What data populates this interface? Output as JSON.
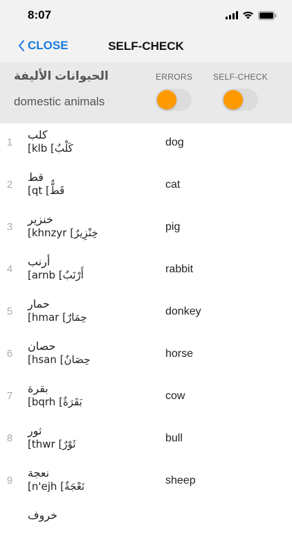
{
  "status": {
    "time": "8:07"
  },
  "nav": {
    "back_label": "CLOSE",
    "title": "SELF-CHECK"
  },
  "header": {
    "arabic_title": "الحيوانات الأليفة",
    "english_title": "domestic animals",
    "errors_label": "ERRORS",
    "selfcheck_label": "SELF-CHECK",
    "accent_color": "#ff9900"
  },
  "words": [
    {
      "num": "1",
      "ar": "كلب",
      "translit": "[klb [كَلْبٌ",
      "en": "dog"
    },
    {
      "num": "2",
      "ar": "قط",
      "translit": "[qt [قَطٌّ",
      "en": "cat"
    },
    {
      "num": "3",
      "ar": "خنزير",
      "translit": "[khnzyr [خِنْزِيرٌ",
      "en": "pig"
    },
    {
      "num": "4",
      "ar": "أرنب",
      "translit": "[arnb [أَرْنَبٌ",
      "en": "rabbit"
    },
    {
      "num": "5",
      "ar": "حمار",
      "translit": "[hmar [حِمَارٌ",
      "en": "donkey"
    },
    {
      "num": "6",
      "ar": "حصان",
      "translit": "[hsan [حِصَانٌ",
      "en": "horse"
    },
    {
      "num": "7",
      "ar": "بقرة",
      "translit": "[bqrh [بَقَرَةٌ",
      "en": "cow"
    },
    {
      "num": "8",
      "ar": "ثور",
      "translit": "[thwr [ثَوْرٌ",
      "en": "bull"
    },
    {
      "num": "9",
      "ar": "نعجة",
      "translit": "[n'ejh [نَعْجَةٌ",
      "en": "sheep"
    },
    {
      "num": "",
      "ar": "خروف",
      "translit": "",
      "en": ""
    }
  ]
}
